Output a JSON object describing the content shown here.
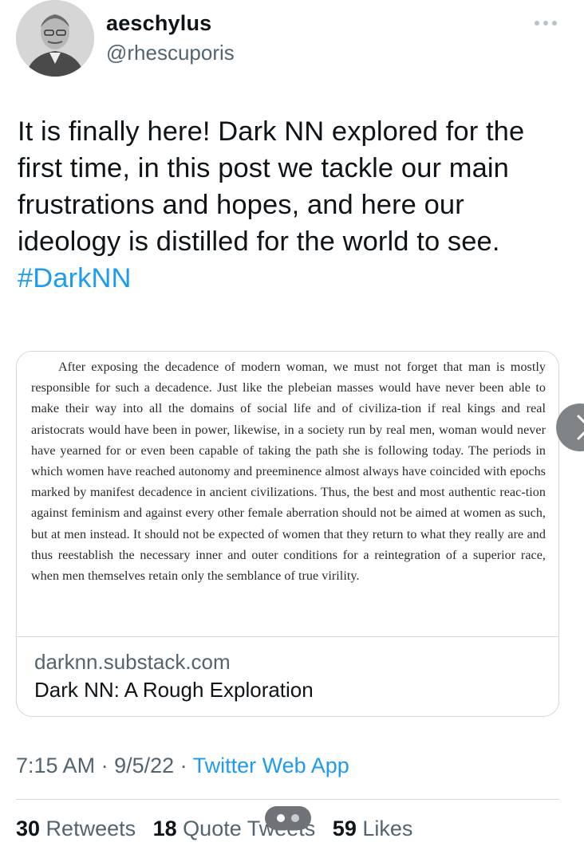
{
  "author": {
    "display_name": "aeschylus",
    "handle": "@rhescuporis",
    "avatar_icon": "person-portrait-avatar"
  },
  "tweet": {
    "text_before_hashtag": "It is finally here! Dark NN explored for the first time, in this post we tackle our main frustrations and hopes, and here our ideology is distilled for the world to see. ",
    "hashtag": "#DarkNN"
  },
  "card": {
    "image_text": "After exposing the decadence of modern woman, we must not forget that man is mostly responsible for such a decadence. Just like the plebeian masses would have never been able to make their way into all the domains of social life and of civiliza-tion if real kings and real aristocrats would have been in power, likewise, in a society run by real men, woman would never have yearned for or even been capable of taking the path she is following today. The periods in which women have reached autonomy and preeminence almost always have coincided with epochs marked by manifest decadence in ancient civilizations. Thus, the best and most authentic reac-tion against feminism and against every other female aberration should not be aimed at women as such, but at men instead. It should not be expected of women that they return to what they really are and thus reestablish the necessary inner and outer conditions for a reintegration of a superior race, when men themselves retain only the semblance of true virility.",
    "domain": "darknn.substack.com",
    "title": "Dark NN: A Rough Exploration"
  },
  "meta": {
    "time": "7:15 AM",
    "sep1": " · ",
    "date": "9/5/22",
    "sep2": " · ",
    "source": "Twitter Web App"
  },
  "stats": {
    "retweets_count": "30",
    "retweets_label": " Retweets",
    "quotes_count": "18",
    "quotes_label": " Quote Tweets",
    "likes_count": "59",
    "likes_label": " Likes"
  },
  "colors": {
    "link_blue": "#1d9bf0",
    "secondary_text": "#536471",
    "primary_text": "#0f1419",
    "border": "#cfd9de"
  }
}
